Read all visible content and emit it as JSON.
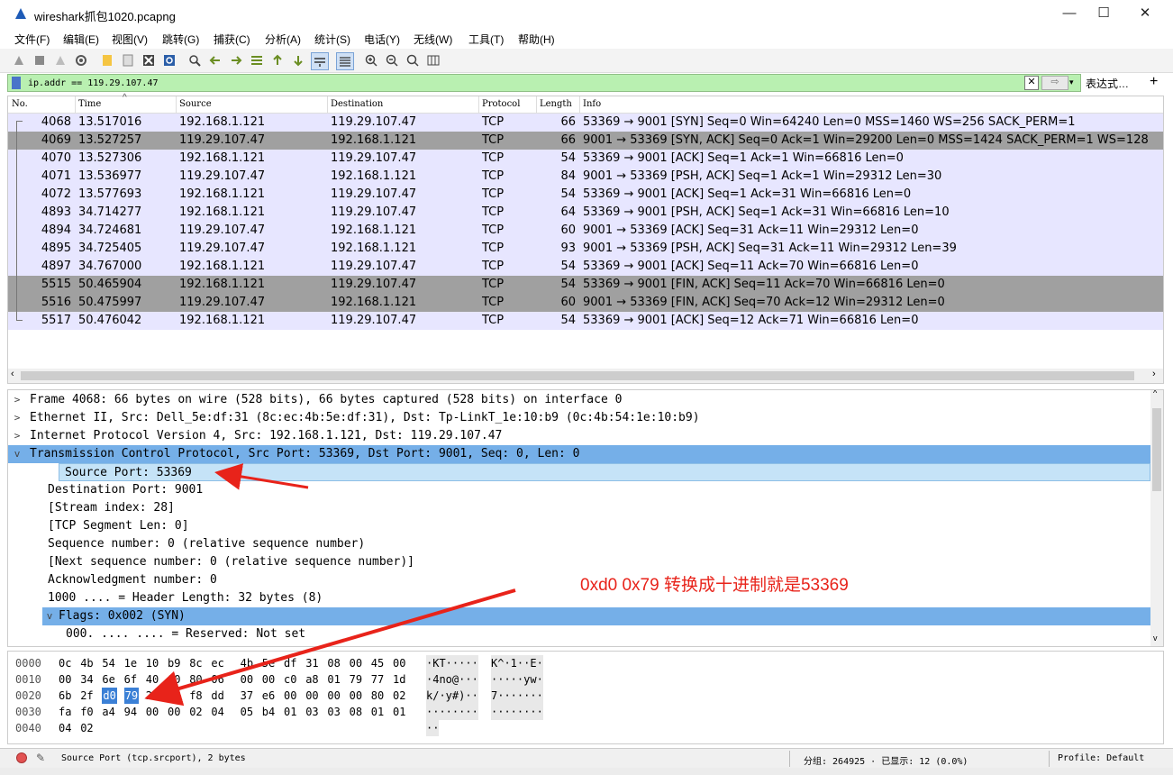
{
  "window": {
    "title": "wireshark抓包1020.pcapng",
    "minimize": "—",
    "maximize": "☐",
    "close": "✕"
  },
  "menu": [
    "文件(F)",
    "编辑(E)",
    "视图(V)",
    "跳转(G)",
    "捕获(C)",
    "分析(A)",
    "统计(S)",
    "电话(Y)",
    "无线(W)",
    "工具(T)",
    "帮助(H)"
  ],
  "filter": {
    "value": "ip.addr == 119.29.107.47",
    "clear_icon": "✕",
    "apply_icon": "⇨",
    "dropdown_icon": "▾",
    "expression_label": "表达式…",
    "add_label": "+"
  },
  "packet_list": {
    "columns": [
      "No.",
      "Time",
      "Source",
      "Destination",
      "Protocol",
      "Length",
      "Info"
    ],
    "rows": [
      {
        "no": "4068",
        "time": "13.517016",
        "src": "192.168.1.121",
        "dst": "119.29.107.47",
        "proto": "TCP",
        "len": "66",
        "info": "53369 → 9001 [SYN] Seq=0 Win=64240 Len=0 MSS=1460 WS=256 SACK_PERM=1",
        "style": "light"
      },
      {
        "no": "4069",
        "time": "13.527257",
        "src": "119.29.107.47",
        "dst": "192.168.1.121",
        "proto": "TCP",
        "len": "66",
        "info": "9001 → 53369 [SYN, ACK] Seq=0 Ack=1 Win=29200 Len=0 MSS=1424 SACK_PERM=1 WS=128",
        "style": "dark"
      },
      {
        "no": "4070",
        "time": "13.527306",
        "src": "192.168.1.121",
        "dst": "119.29.107.47",
        "proto": "TCP",
        "len": "54",
        "info": "53369 → 9001 [ACK] Seq=1 Ack=1 Win=66816 Len=0",
        "style": "light"
      },
      {
        "no": "4071",
        "time": "13.536977",
        "src": "119.29.107.47",
        "dst": "192.168.1.121",
        "proto": "TCP",
        "len": "84",
        "info": "9001 → 53369 [PSH, ACK] Seq=1 Ack=1 Win=29312 Len=30",
        "style": "light"
      },
      {
        "no": "4072",
        "time": "13.577693",
        "src": "192.168.1.121",
        "dst": "119.29.107.47",
        "proto": "TCP",
        "len": "54",
        "info": "53369 → 9001 [ACK] Seq=1 Ack=31 Win=66816 Len=0",
        "style": "light"
      },
      {
        "no": "4893",
        "time": "34.714277",
        "src": "192.168.1.121",
        "dst": "119.29.107.47",
        "proto": "TCP",
        "len": "64",
        "info": "53369 → 9001 [PSH, ACK] Seq=1 Ack=31 Win=66816 Len=10",
        "style": "light"
      },
      {
        "no": "4894",
        "time": "34.724681",
        "src": "119.29.107.47",
        "dst": "192.168.1.121",
        "proto": "TCP",
        "len": "60",
        "info": "9001 → 53369 [ACK] Seq=31 Ack=11 Win=29312 Len=0",
        "style": "light"
      },
      {
        "no": "4895",
        "time": "34.725405",
        "src": "119.29.107.47",
        "dst": "192.168.1.121",
        "proto": "TCP",
        "len": "93",
        "info": "9001 → 53369 [PSH, ACK] Seq=31 Ack=11 Win=29312 Len=39",
        "style": "light"
      },
      {
        "no": "4897",
        "time": "34.767000",
        "src": "192.168.1.121",
        "dst": "119.29.107.47",
        "proto": "TCP",
        "len": "54",
        "info": "53369 → 9001 [ACK] Seq=11 Ack=70 Win=66816 Len=0",
        "style": "light"
      },
      {
        "no": "5515",
        "time": "50.465904",
        "src": "192.168.1.121",
        "dst": "119.29.107.47",
        "proto": "TCP",
        "len": "54",
        "info": "53369 → 9001 [FIN, ACK] Seq=11 Ack=70 Win=66816 Len=0",
        "style": "dark"
      },
      {
        "no": "5516",
        "time": "50.475997",
        "src": "119.29.107.47",
        "dst": "192.168.1.121",
        "proto": "TCP",
        "len": "60",
        "info": "9001 → 53369 [FIN, ACK] Seq=70 Ack=12 Win=29312 Len=0",
        "style": "dark"
      },
      {
        "no": "5517",
        "time": "50.476042",
        "src": "192.168.1.121",
        "dst": "119.29.107.47",
        "proto": "TCP",
        "len": "54",
        "info": "53369 → 9001 [ACK] Seq=12 Ack=71 Win=66816 Len=0",
        "style": "light"
      }
    ]
  },
  "details": [
    {
      "exp": ">",
      "text": "Frame 4068: 66 bytes on wire (528 bits), 66 bytes captured (528 bits) on interface 0",
      "indent": 0,
      "style": ""
    },
    {
      "exp": ">",
      "text": "Ethernet II, Src: Dell_5e:df:31 (8c:ec:4b:5e:df:31), Dst: Tp-LinkT_1e:10:b9 (0c:4b:54:1e:10:b9)",
      "indent": 0,
      "style": ""
    },
    {
      "exp": ">",
      "text": "Internet Protocol Version 4, Src: 192.168.1.121, Dst: 119.29.107.47",
      "indent": 0,
      "style": ""
    },
    {
      "exp": "v",
      "text": "Transmission Control Protocol, Src Port: 53369, Dst Port: 9001, Seq: 0, Len: 0",
      "indent": 0,
      "style": "blue"
    },
    {
      "exp": "",
      "text": "Source Port: 53369",
      "indent": 1,
      "style": "lightblue"
    },
    {
      "exp": "",
      "text": "Destination Port: 9001",
      "indent": 1,
      "style": ""
    },
    {
      "exp": "",
      "text": "[Stream index: 28]",
      "indent": 1,
      "style": ""
    },
    {
      "exp": "",
      "text": "[TCP Segment Len: 0]",
      "indent": 1,
      "style": ""
    },
    {
      "exp": "",
      "text": "Sequence number: 0    (relative sequence number)",
      "indent": 1,
      "style": ""
    },
    {
      "exp": "",
      "text": "[Next sequence number: 0    (relative sequence number)]",
      "indent": 1,
      "style": ""
    },
    {
      "exp": "",
      "text": "Acknowledgment number: 0",
      "indent": 1,
      "style": ""
    },
    {
      "exp": "",
      "text": "1000 .... = Header Length: 32 bytes (8)",
      "indent": 1,
      "style": ""
    },
    {
      "exp": "v",
      "text": "Flags: 0x002 (SYN)",
      "indent": 1,
      "style": "blue"
    },
    {
      "exp": "",
      "text": "000. .... .... = Reserved: Not set",
      "indent": 2,
      "style": ""
    }
  ],
  "bytes": {
    "offsets": [
      "0000",
      "0010",
      "0020",
      "0030",
      "0040"
    ],
    "hex": [
      [
        "0c",
        "4b",
        "54",
        "1e",
        "10",
        "b9",
        "8c",
        "ec",
        "4b",
        "5e",
        "df",
        "31",
        "08",
        "00",
        "45",
        "00"
      ],
      [
        "00",
        "34",
        "6e",
        "6f",
        "40",
        "00",
        "80",
        "06",
        "00",
        "00",
        "c0",
        "a8",
        "01",
        "79",
        "77",
        "1d"
      ],
      [
        "6b",
        "2f",
        "d0",
        "79",
        "23",
        "29",
        "f8",
        "dd",
        "37",
        "e6",
        "00",
        "00",
        "00",
        "00",
        "80",
        "02"
      ],
      [
        "fa",
        "f0",
        "a4",
        "94",
        "00",
        "00",
        "02",
        "04",
        "05",
        "b4",
        "01",
        "03",
        "03",
        "08",
        "01",
        "01"
      ],
      [
        "04",
        "02"
      ]
    ],
    "ascii": [
      [
        "·KT·····",
        "K^·1··E·"
      ],
      [
        "·4no@···",
        "·····yw·"
      ],
      [
        "k/·y#)··",
        "7·······"
      ],
      [
        "········",
        "········"
      ],
      [
        "··",
        ""
      ]
    ]
  },
  "status": {
    "field": "Source Port (tcp.srcport), 2 bytes",
    "packets": "分组: 264925 · 已显示: 12 (0.0%)",
    "profile": "Profile: Default",
    "edit_icon": "✎"
  },
  "annotation": {
    "text": "0xd0 0x79 转换成十进制就是53369",
    "color": "#e8231a"
  },
  "colors": {
    "filter_bg": "#b9f0b1",
    "row_light": "#e7e6ff",
    "row_dark": "#a0a0a0",
    "selection": "#75afe8",
    "byte_highlight": "#3b80d6"
  }
}
